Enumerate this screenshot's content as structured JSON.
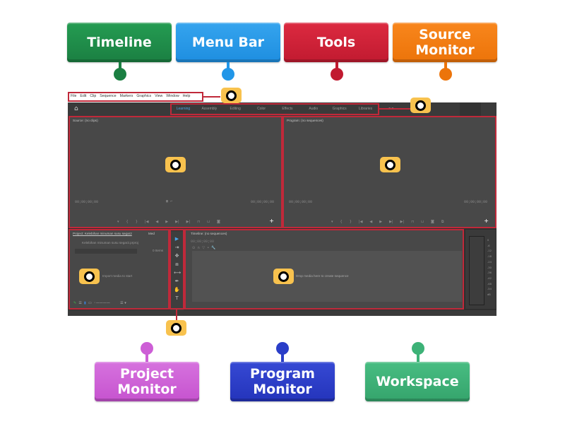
{
  "labels": [
    {
      "id": "timeline",
      "text": "Timeline",
      "color": "#1e8a48"
    },
    {
      "id": "menu-bar",
      "text": "Menu Bar",
      "color": "#2196e8"
    },
    {
      "id": "tools",
      "text": "Tools",
      "color": "#d21f36"
    },
    {
      "id": "source-monitor",
      "text": "Source Monitor",
      "color": "#f57c10"
    },
    {
      "id": "project-monitor",
      "text": "Project Monitor",
      "color": "#cd5ed6"
    },
    {
      "id": "program-monitor",
      "text": "Program Monitor",
      "color": "#2a3ec8"
    },
    {
      "id": "workspace",
      "text": "Workspace",
      "color": "#3db277"
    }
  ],
  "app": {
    "menu": [
      "File",
      "Edit",
      "Clip",
      "Sequence",
      "Markers",
      "Graphics",
      "View",
      "Window",
      "Help"
    ],
    "workspaces": [
      "Learning",
      "Assembly",
      "Editing",
      "Color",
      "Effects",
      "Audio",
      "Graphics",
      "Libraries"
    ],
    "workspace_active": "Learning",
    "workspace_more": ">>",
    "source": {
      "title": "Source: (no clips)",
      "tc_left": "00;00;00;00",
      "tc_right": "00;00;00;00"
    },
    "program": {
      "title": "Program: (no sequences)",
      "tc_left": "00;00;00;00",
      "tc_right": "00;00;00;00"
    },
    "project": {
      "tab": "Project: Kelebihan minuman susu segar2",
      "tab2": "Med",
      "file": "Kelebihan minuman susu segar2.prproj",
      "items": "0 Items",
      "empty": "Import media to start"
    },
    "timeline": {
      "title": "Timeline: (no sequences)",
      "tc": "00;00;00;00",
      "empty": "Drop media here to create sequence"
    },
    "meter_scale": [
      "0",
      "-6",
      "-12",
      "-18",
      "-24",
      "-30",
      "-36",
      "-42",
      "-48",
      "-54",
      "dB"
    ]
  },
  "icons": {
    "home": "⌂",
    "tools": [
      "▶",
      "⇥",
      "✥",
      "⧈",
      "⟷",
      "✒",
      "✋",
      "T"
    ]
  }
}
